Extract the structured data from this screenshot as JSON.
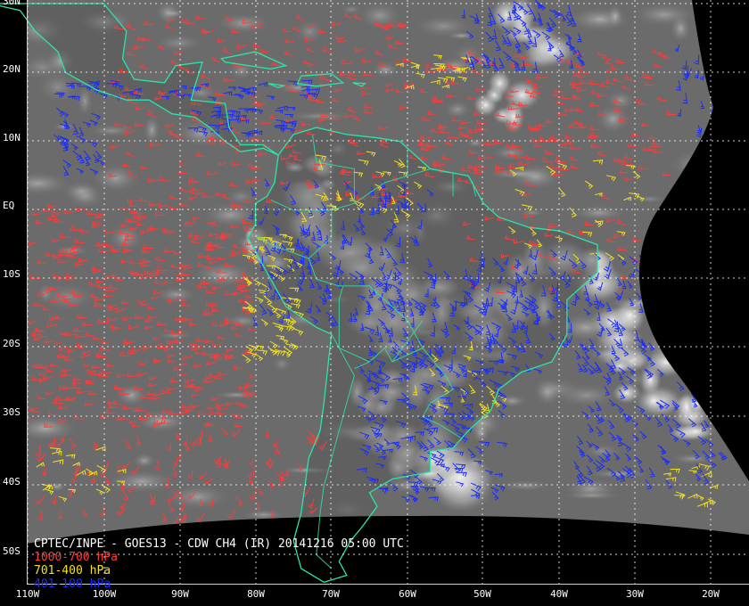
{
  "product_title": "CPTEC/INPE - GOES13 - CDW CH4 (IR) 20141216 05:00 UTC",
  "legend": [
    {
      "label": "1000-700 hPa",
      "color": "#ff3b3b"
    },
    {
      "label": "701-400 hPa",
      "color": "#f2e21e"
    },
    {
      "label": "401-100 hPa",
      "color": "#1a2cff"
    }
  ],
  "lat_labels": [
    "30N",
    "20N",
    "10N",
    "EQ",
    "10S",
    "20S",
    "30S",
    "40S",
    "50S"
  ],
  "lon_labels": [
    "110W",
    "100W",
    "90W",
    "80W",
    "70W",
    "60W",
    "50W",
    "40W",
    "30W",
    "20W"
  ],
  "colors": {
    "coastline": "#28e6a8",
    "grid": "#ffffff",
    "space": "#000000",
    "cloud_background": "#6e6e6e"
  }
}
